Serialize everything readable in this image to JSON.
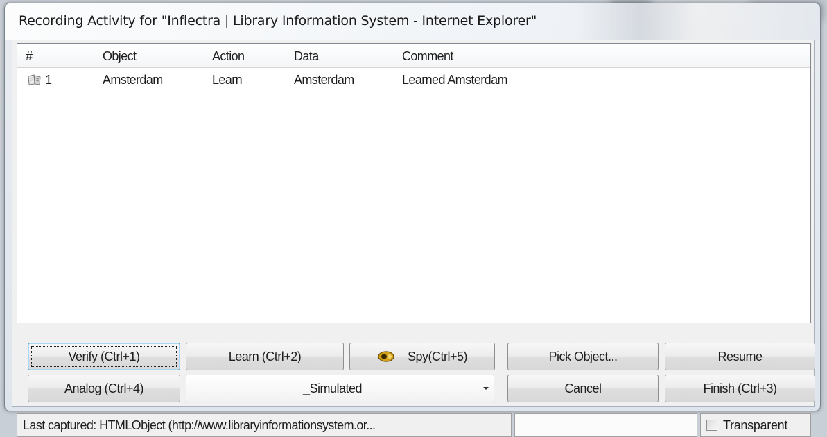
{
  "window": {
    "title": "Recording Activity for \"Inflectra | Library Information System - Internet Explorer\""
  },
  "listview": {
    "columns": [
      "#",
      "Object",
      "Action",
      "Data",
      "Comment"
    ],
    "rows": [
      {
        "num": "1",
        "object": "Amsterdam",
        "action": "Learn",
        "data": "Amsterdam",
        "comment": "Learned Amsterdam",
        "icon": "learn-book-icon"
      }
    ]
  },
  "buttons": {
    "verify": "Verify (Ctrl+1)",
    "learn": "Learn (Ctrl+2)",
    "spy": "Spy(Ctrl+5)",
    "pick_object": "Pick Object...",
    "resume": "Resume",
    "analog": "Analog (Ctrl+4)",
    "cancel": "Cancel",
    "finish": "Finish (Ctrl+3)"
  },
  "mode_select": {
    "selected": "_Simulated"
  },
  "status": {
    "last_captured": "Last captured:  HTMLObject (http://www.libraryinformationsystem.or...",
    "transparent_label": "Transparent",
    "transparent_checked": false
  },
  "colors": {
    "default_button_border": "#3c7fb1",
    "spy_icon": "#d4a017"
  }
}
